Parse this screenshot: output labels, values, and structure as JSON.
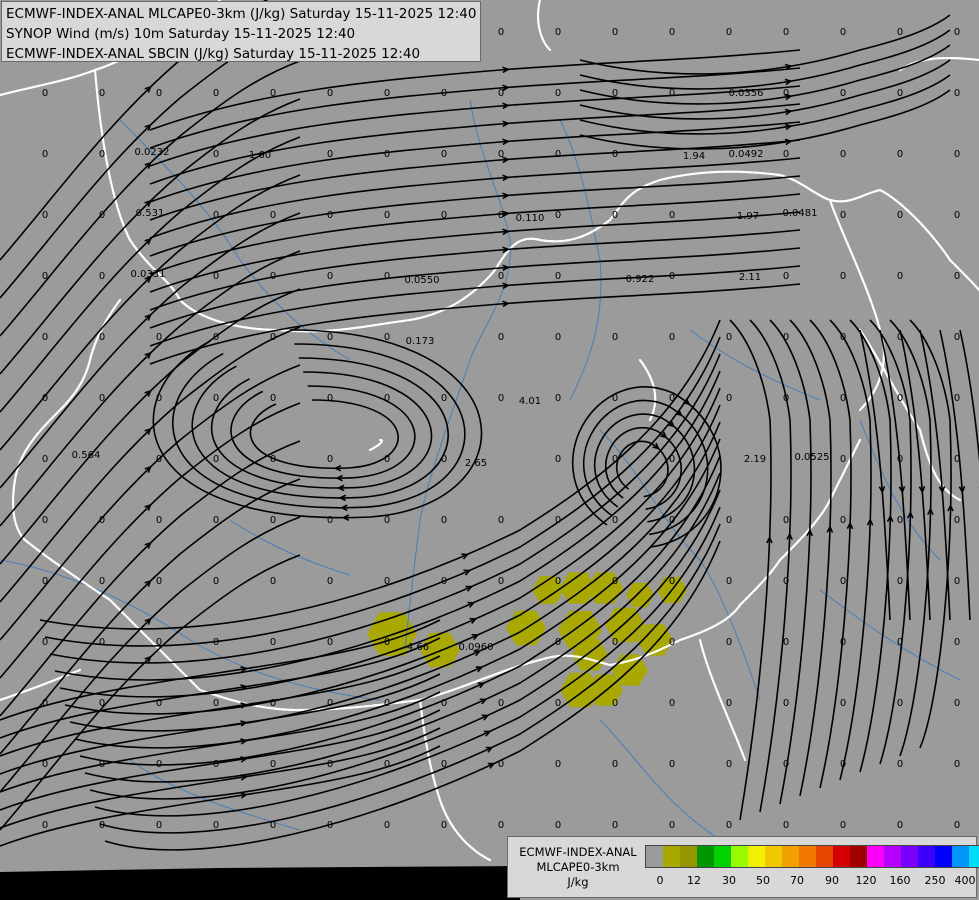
{
  "header": {
    "lines": [
      "ECMWF-INDEX-ANAL MLCAPE0-3km (J/kg) Saturday 15-11-2025 12:40",
      "SYNOP Wind (m/s) 10m Saturday 15-11-2025 12:40",
      "ECMWF-INDEX-ANAL SBCIN (J/kg) Saturday 15-11-2025 12:40"
    ]
  },
  "legend": {
    "title_lines": [
      "ECMWF-INDEX-ANAL",
      "MLCAPE0-3km",
      "J/kg"
    ],
    "colors": [
      "#9b9b9b",
      "#a8a800",
      "#959500",
      "#009600",
      "#00d200",
      "#96fa00",
      "#f0f000",
      "#f0c800",
      "#f0a000",
      "#f07800",
      "#e64600",
      "#d20000",
      "#a00000",
      "#fa00fa",
      "#b400fa",
      "#7800fa",
      "#3c00fa",
      "#0000fa",
      "#0096fa",
      "#00dcfa",
      "#96fafa",
      "#fafafa"
    ],
    "tick_labels": [
      "0",
      "12",
      "30",
      "50",
      "70",
      "90",
      "120",
      "160",
      "250",
      "400"
    ]
  },
  "map": {
    "cape_color": "#a8a800",
    "border_color": "#ffffff",
    "river_color": "#4a7fb8",
    "streamline_color": "#000000",
    "cape_values": [
      "0.0232",
      "1.60",
      "0.531",
      "0.0331",
      "0.0550",
      "0.173",
      "0.110",
      "0.922",
      "4.01",
      "2.65",
      "0.564",
      "4.66",
      "0.0960",
      "0.0356",
      "0.0492",
      "0.0481",
      "1.94",
      "1.97",
      "2.11",
      "0.0525",
      "2.19"
    ],
    "zero_label": "0"
  }
}
